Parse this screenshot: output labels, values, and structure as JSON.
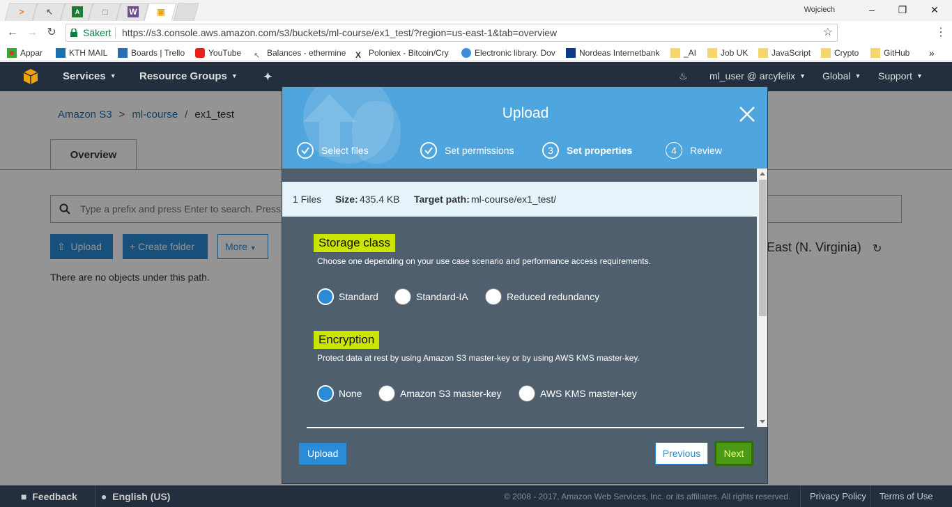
{
  "browser": {
    "user_name": "Wojciech",
    "security_label": "Säkert",
    "url": "https://s3.console.aws.amazon.com/s3/buckets/ml-course/ex1_test/?region=us-east-1&tab=overview",
    "bookmarks": [
      {
        "label": "Appar",
        "icon": "apps-grid-icon"
      },
      {
        "label": "KTH MAIL",
        "icon": "outlook-icon"
      },
      {
        "label": "Boards | Trello",
        "icon": "trello-icon"
      },
      {
        "label": "YouTube",
        "icon": "youtube-icon"
      },
      {
        "label": "Balances - ethermine",
        "icon": "ethermine-icon"
      },
      {
        "label": "Poloniex - Bitcoin/Cry",
        "icon": "poloniex-icon"
      },
      {
        "label": "Electronic library. Dov",
        "icon": "globe-icon"
      },
      {
        "label": "Nordeas Internetbank",
        "icon": "bank-icon"
      },
      {
        "label": "_AI",
        "icon": "folder-icon"
      },
      {
        "label": "Job UK",
        "icon": "folder-icon"
      },
      {
        "label": "JavaScript",
        "icon": "folder-icon"
      },
      {
        "label": "Crypto",
        "icon": "folder-icon"
      },
      {
        "label": "GitHub",
        "icon": "folder-icon"
      }
    ],
    "more_bookmarks": "»"
  },
  "aws_nav": {
    "services": "Services",
    "resource_groups": "Resource Groups",
    "user": "ml_user @ arcyfelix",
    "region": "Global",
    "support": "Support"
  },
  "page": {
    "breadcrumb": [
      "Amazon S3",
      "ml-course",
      "ex1_test"
    ],
    "tab_overview": "Overview",
    "search_placeholder": "Type a prefix and press Enter to search. Press",
    "upload_button": "Upload",
    "create_folder_button": "Create folder",
    "more_button": "More",
    "empty_message": "There are no objects under this path.",
    "region_text": "East (N. Virginia)"
  },
  "modal": {
    "title": "Upload",
    "steps": [
      {
        "number": "1",
        "label": "Select files",
        "state": "done"
      },
      {
        "number": "2",
        "label": "Set permissions",
        "state": "done"
      },
      {
        "number": "3",
        "label": "Set properties",
        "state": "current"
      },
      {
        "number": "4",
        "label": "Review",
        "state": "pending"
      }
    ],
    "summary": {
      "files": "1 Files",
      "size_label": "Size:",
      "size_value": "435.4 KB",
      "target_label": "Target path:",
      "target_value": "ml-course/ex1_test/"
    },
    "storage": {
      "title": "Storage class",
      "description": "Choose one depending on your use case scenario and performance access requirements.",
      "options": [
        "Standard",
        "Standard-IA",
        "Reduced redundancy"
      ],
      "selected": "Standard"
    },
    "encryption": {
      "title": "Encryption",
      "description": "Protect data at rest by using Amazon S3 master-key or by using AWS KMS master-key.",
      "options": [
        "None",
        "Amazon S3 master-key",
        "AWS KMS master-key"
      ],
      "selected": "None"
    },
    "upload_button": "Upload",
    "previous_button": "Previous",
    "next_button": "Next"
  },
  "footer": {
    "feedback": "Feedback",
    "language": "English (US)",
    "copyright": "© 2008 - 2017, Amazon Web Services, Inc. or its affiliates. All rights reserved.",
    "privacy": "Privacy Policy",
    "terms": "Terms of Use"
  },
  "colors": {
    "aws_header": "#232f3e",
    "modal_header": "#4fa5dd",
    "modal_body": "#4f5f6e",
    "accent_blue": "#2a8bd6",
    "highlight": "#c9e500",
    "next_button": "#4a9a18"
  }
}
